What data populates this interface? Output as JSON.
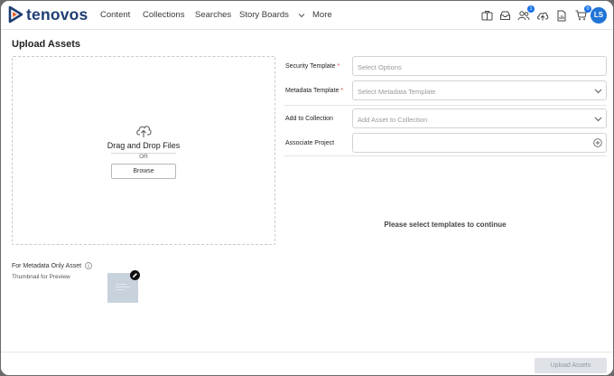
{
  "app": {
    "name": "tenovos"
  },
  "nav": {
    "items": [
      "Content",
      "Collections",
      "Searches",
      "Story Boards"
    ],
    "more_label": "More"
  },
  "header_icons": {
    "briefcase": "briefcase-icon",
    "inbox": "inbox-icon",
    "users": "users-icon",
    "users_badge": "1",
    "upload": "cloud-upload-icon",
    "reports": "document-chart-icon",
    "cart": "cart-icon",
    "cart_badge": "0"
  },
  "user": {
    "initials": "LS",
    "avatar_color": "#1f74d4"
  },
  "page": {
    "title": "Upload Assets"
  },
  "dropzone": {
    "text": "Drag and Drop Files",
    "or_text": "OR",
    "browse_label": "Browse"
  },
  "form": {
    "security_template": {
      "label": "Security Template",
      "required": "*",
      "placeholder": "Select Options"
    },
    "metadata_template": {
      "label": "Metadata Template",
      "required": "*",
      "placeholder": "Select Metadata Template"
    },
    "add_to_collection": {
      "label": "Add to Collection",
      "placeholder": "Add Asset to Collection"
    },
    "associate_project": {
      "label": "Associate Project",
      "value": ""
    }
  },
  "empty_message": "Please select templates to continue",
  "metadata_only": {
    "label": "For Metadata Only Asset",
    "thumbnail_label": "Thumbnail for Preview"
  },
  "footer": {
    "upload_label": "Upload Assets"
  },
  "colors": {
    "brand": "#1f3d73",
    "accent": "#e8642b",
    "primary": "#1f74d4",
    "required": "#d64545"
  }
}
